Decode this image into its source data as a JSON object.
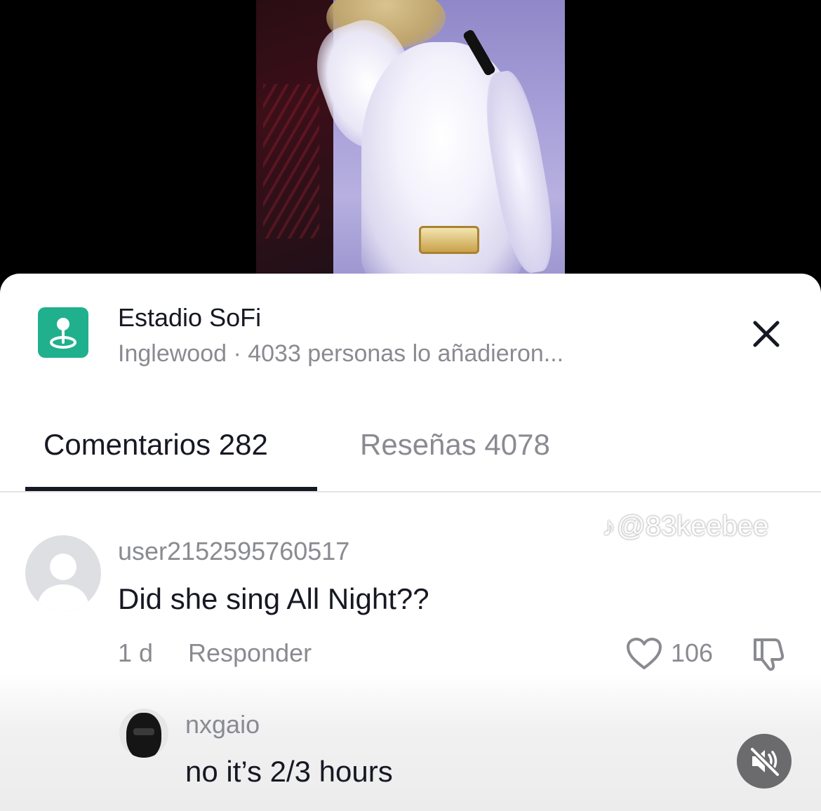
{
  "location": {
    "icon": "location-pin-icon",
    "name": "Estadio SoFi",
    "meta": "Inglewood · 4033 personas lo añadieron..."
  },
  "tabs": [
    {
      "label": "Comentarios 282",
      "active": true
    },
    {
      "label": "Reseñas 4078",
      "active": false
    }
  ],
  "watermark": {
    "icon": "tiktok-icon",
    "handle": "@83keebee"
  },
  "comment": {
    "username": "user2152595760517",
    "text": "Did she sing All Night??",
    "time": "1 d",
    "reply_label": "Responder",
    "likes": "106"
  },
  "reply": {
    "username": "nxgaio",
    "text": "no it’s 2/3 hours"
  },
  "colors": {
    "accent": "#20b08d",
    "text_primary": "#161823",
    "text_secondary": "#8a8b91"
  }
}
